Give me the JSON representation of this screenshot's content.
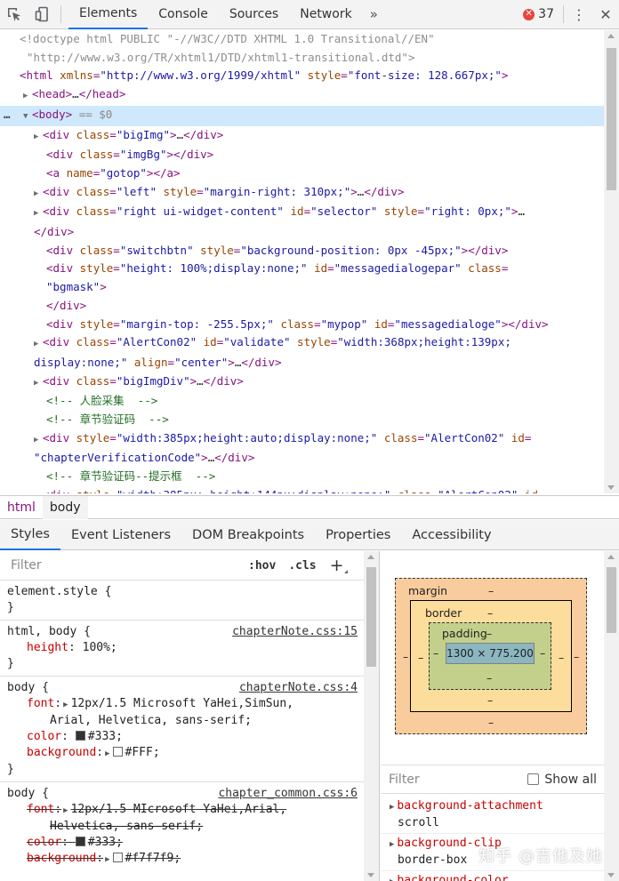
{
  "toolbar": {
    "tabs": [
      "Elements",
      "Console",
      "Sources",
      "Network"
    ],
    "error_count": "37"
  },
  "elements": {
    "selected_marker": "== $0",
    "lines": [
      {
        "id": "doctype1",
        "text": "<!doctype html PUBLIC \"-//W3C//DTD XHTML 1.0 Transitional//EN\""
      },
      {
        "id": "doctype2",
        "text": "\"http://www.w3.org/TR/xhtml1/DTD/xhtml1-transitional.dtd\">"
      }
    ],
    "html_attr_xmlns": "\"http://www.w3.org/1999/xhtml\"",
    "html_attr_style": "\"font-size: 128.667px;\"",
    "comment_face": "<!-- 人脸采集  -->",
    "comment_chapter": "<!-- 章节验证码  -->",
    "comment_chapter_tip": "<!-- 章节验证码--提示框  -->"
  },
  "breadcrumb": [
    "html",
    "body"
  ],
  "lower_tabs": [
    "Styles",
    "Event Listeners",
    "DOM Breakpoints",
    "Properties",
    "Accessibility"
  ],
  "styles": {
    "filter_placeholder": "Filter",
    "hov": ":hov",
    "cls": ".cls",
    "rules": [
      {
        "selector": "element.style {",
        "source": ""
      },
      {
        "selector": "html, body {",
        "source": "chapterNote.css:15"
      },
      {
        "selector": "body {",
        "source": "chapterNote.css:4"
      },
      {
        "selector": "body {",
        "source": "chapter_common.css:6"
      }
    ],
    "rule1_height_name": "height",
    "rule1_height_val": "100%;",
    "rule2_font_name": "font",
    "rule2_font_val": "12px/1.5 Microsoft YaHei,SimSun,",
    "rule2_font_val2": "Arial, Helvetica, sans-serif;",
    "rule2_color_name": "color",
    "rule2_color_val": "#333;",
    "rule2_bg_name": "background",
    "rule2_bg_val": "#FFF;",
    "rule3_font_name": "font",
    "rule3_font_val": "12px/1.5 MIcrosoft YaHei,Arial,",
    "rule3_font_val2": "Helvetica, sans-serif;",
    "rule3_color_name": "color",
    "rule3_color_val": "#333;",
    "rule3_bg_name": "background",
    "rule3_bg_val": "#f7f7f9;",
    "colors": {
      "c333": "#333333",
      "cfff": "#FFFFFF",
      "cf7f7f9": "#f7f7f9"
    }
  },
  "boxmodel": {
    "margin_label": "margin",
    "border_label": "border",
    "padding_label": "padding",
    "content": "1300 × 775.200",
    "dash": "–"
  },
  "computed": {
    "filter_placeholder": "Filter",
    "show_all": "Show all",
    "items": [
      {
        "name": "background-attachment",
        "value": "scroll"
      },
      {
        "name": "background-clip",
        "value": "border-box"
      },
      {
        "name": "background-color",
        "value": ""
      }
    ]
  },
  "watermark": "知乎 @吉他及她"
}
